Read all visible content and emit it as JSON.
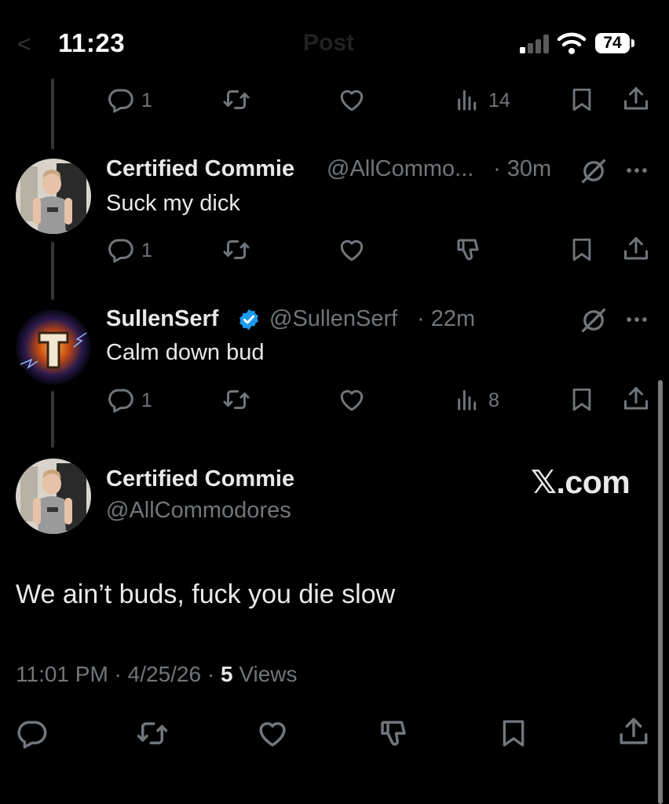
{
  "status_bar": {
    "time": "11:23",
    "battery": "74"
  },
  "header": {
    "back_glyph": "<",
    "title": "Post"
  },
  "top_actions": {
    "reply_count": "1",
    "view_count": "14"
  },
  "replies": [
    {
      "name": "Certified Commie",
      "handle": "@AllCommo...",
      "time": "· 30m",
      "text": "Suck my dick",
      "reply_count": "1"
    },
    {
      "name": "SullenSerf",
      "handle": "@SullenSerf",
      "time": "· 22m",
      "text": "Calm down bud",
      "reply_count": "1",
      "view_count": "8"
    }
  ],
  "main_post": {
    "name": "Certified Commie",
    "handle": "@AllCommodores",
    "text": "We ain’t buds, fuck you die slow",
    "timestamp": "11:01 PM · 4/25/26 · ",
    "views_count": "5",
    "views_label": " Views"
  },
  "watermark": "𝕏.com",
  "icons": {
    "reply": "reply-bubble-icon",
    "repost": "repost-arrows-icon",
    "like": "heart-icon",
    "dislike": "thumbs-down-icon",
    "views": "bar-chart-icon",
    "bookmark": "bookmark-icon",
    "share": "share-upload-icon",
    "grok": "grok-slash-icon",
    "more": "more-dots-icon"
  },
  "colors": {
    "background": "#000000",
    "text": "#e7e9ea",
    "muted": "#71767b",
    "verified": "#1d9bf0"
  }
}
